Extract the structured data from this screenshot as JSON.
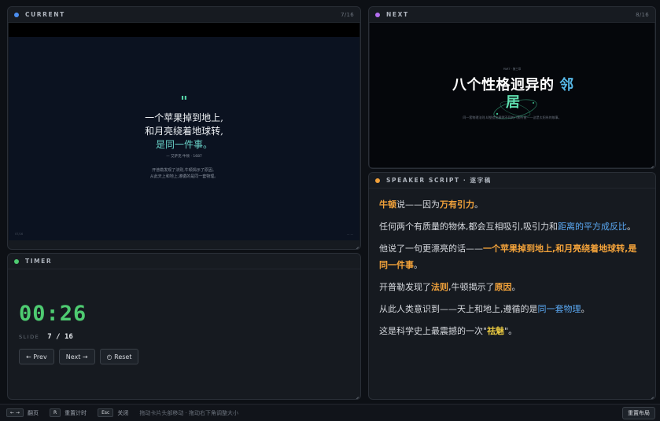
{
  "current": {
    "header": "CURRENT",
    "count": "7/16",
    "dot_color": "#4b8ef0",
    "slide": {
      "quote_mark": "\"",
      "lines": [
        "一个苹果掉到地上,",
        "和月亮绕着地球转,",
        "是同一件事。"
      ],
      "source": "— 艾萨克·牛顿 · 1687",
      "note1": "开普勒发现了法则,牛顿揭示了原因。",
      "note2": "从此天上和地上,遵循的是同一套物理。",
      "corner_left": "07/16",
      "corner_right": "— —"
    }
  },
  "next": {
    "header": "NEXT",
    "count": "8/16",
    "dot_color": "#b46ef0",
    "slide": {
      "kicker": "PART · 第三章",
      "title_main": "八个性格迥异的",
      "title_accent": "邻",
      "title_line2": "居",
      "subtitle": "同一套物理法则,却塑造出截然不同的八颗行星——这是太阳系的故事。"
    }
  },
  "script": {
    "header": "SPEAKER SCRIPT · 逐字稿",
    "dot_color": "#f0a03a",
    "p1": {
      "a": "牛顿",
      "b": "说——因为",
      "c": "万有引力",
      "d": "。"
    },
    "p2": {
      "a": "任何两个有质量的物体,都会互相吸引,吸引力和",
      "b": "距离的平方成反比",
      "c": "。"
    },
    "p3": {
      "a": "他说了一句更漂亮的话——",
      "b": "一个苹果掉到地上,和月亮绕着地球转,是同一件事",
      "c": "。"
    },
    "p4": {
      "a": "开普勒发现了",
      "b": "法则",
      "c": ",牛顿揭示了",
      "d": "原因",
      "e": "。"
    },
    "p5": {
      "a": "从此人类意识到——天上和地上,遵循的是",
      "b": "同一套物理",
      "c": "。"
    },
    "p6": {
      "a": "这是科学史上最震撼的一次\"",
      "b": "祛魅",
      "c": "\"。"
    }
  },
  "timer": {
    "header": "TIMER",
    "dot_color": "#4ecb71",
    "time": "00:26",
    "slide_label": "SLIDE",
    "slide_value": "7 / 16",
    "prev_label": "← Prev",
    "next_label": "Next →",
    "reset_label": "◴ Reset"
  },
  "footer": {
    "key_nav": "← →",
    "nav_label": "翻页",
    "key_reset": "R",
    "reset_label": "重置计时",
    "key_esc": "Esc",
    "esc_label": "关闭",
    "hint": "拖动卡片头部移动 · 拖动右下角调整大小",
    "reset_layout": "重置布局"
  }
}
